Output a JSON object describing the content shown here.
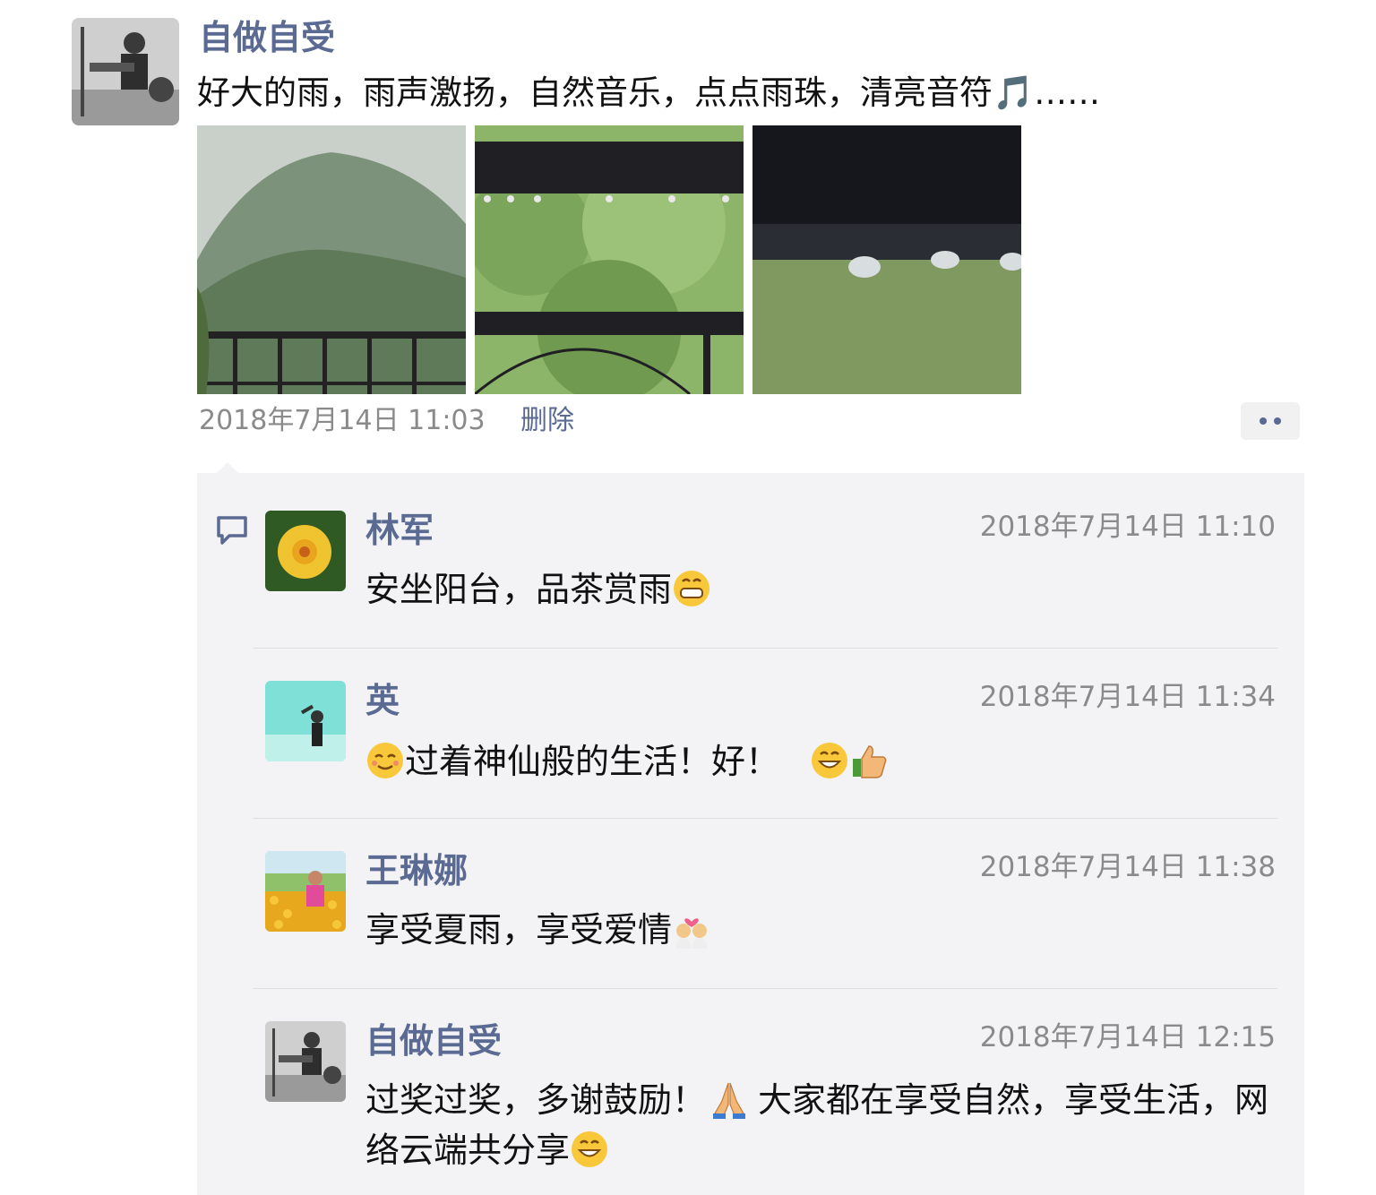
{
  "post": {
    "author": "自做自受",
    "text": "好大的雨，雨声激扬，自然音乐，点点雨珠，清亮音符🎵……",
    "time": "2018年7月14日 11:03",
    "delete_label": "删除"
  },
  "comments": [
    {
      "name": "林军",
      "time": "2018年7月14日 11:10",
      "text": "安坐阳台，品茶赏雨",
      "emoji": [
        "grin-icon"
      ]
    },
    {
      "name": "英",
      "time": "2018年7月14日 11:34",
      "text_before": "",
      "text": "过着神仙般的生活！好！",
      "emoji": [
        "relieved-icon",
        "smile-icon",
        "thumbs-up-icon"
      ]
    },
    {
      "name": "王琳娜",
      "time": "2018年7月14日 11:38",
      "text": "享受夏雨，享受爱情",
      "emoji": [
        "couple-heart-icon"
      ]
    },
    {
      "name": "自做自受",
      "time": "2018年7月14日 12:15",
      "text_part1": "过奖过奖，多谢鼓励！",
      "text_part2": "大家都在享受自然，享受生活，网络云端共分享",
      "emoji": [
        "pray-icon",
        "smile-icon"
      ]
    }
  ],
  "colors": {
    "link": "#5b6a92",
    "meta": "#8a8a8a",
    "comment_bg": "#f3f3f5"
  }
}
